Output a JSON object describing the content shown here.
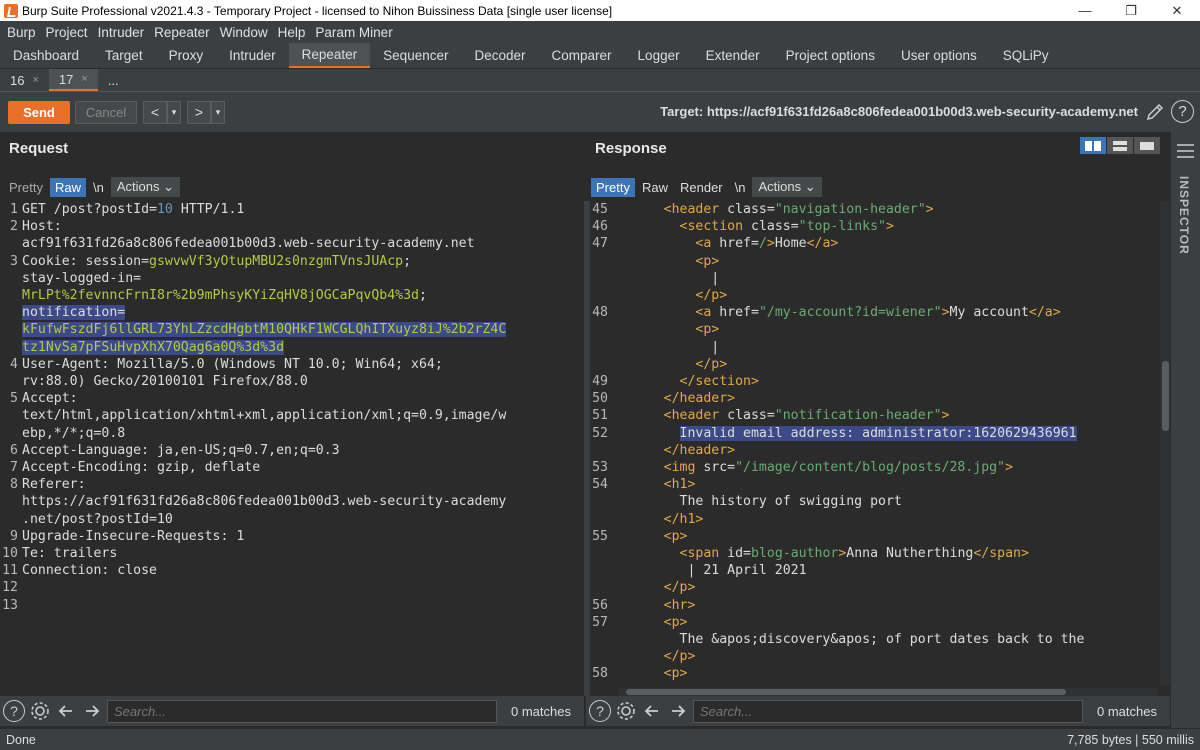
{
  "window": {
    "title": "Burp Suite Professional v2021.4.3 - Temporary Project - licensed to Nihon Buissiness Data [single user license]",
    "minimize": "—",
    "restore": "❐",
    "close": "✕"
  },
  "menu": [
    "Burp",
    "Project",
    "Intruder",
    "Repeater",
    "Window",
    "Help",
    "Param Miner"
  ],
  "tabs": [
    "Dashboard",
    "Target",
    "Proxy",
    "Intruder",
    "Repeater",
    "Sequencer",
    "Decoder",
    "Comparer",
    "Logger",
    "Extender",
    "Project options",
    "User options",
    "SQLiPy"
  ],
  "active_tab": "Repeater",
  "subtabs": [
    {
      "label": "16",
      "close": "×"
    },
    {
      "label": "17",
      "close": "×"
    },
    {
      "label": "...",
      "close": ""
    }
  ],
  "toolbar": {
    "send": "Send",
    "cancel": "Cancel",
    "back": "<",
    "back_dd": "▾",
    "fwd": ">",
    "fwd_dd": "▾",
    "target_label": "Target:",
    "target_url": "https://acf91f631fd26a8c806fedea001b00d3.web-security-academy.net",
    "help": "?"
  },
  "request": {
    "title": "Request",
    "formats": [
      "Pretty",
      "Raw",
      "\\n"
    ],
    "active_format": "Raw",
    "actions": "Actions ⌄"
  },
  "response": {
    "title": "Response",
    "formats": [
      "Pretty",
      "Raw",
      "Render",
      "\\n"
    ],
    "active_format": "Pretty",
    "actions": "Actions ⌄"
  },
  "inspector": {
    "label": "INSPECTOR"
  },
  "search": {
    "placeholder": "Search...",
    "req_matches": "0 matches",
    "resp_matches": "0 matches",
    "help": "?"
  },
  "status": {
    "left": "Done",
    "right": "7,785 bytes | 550 millis"
  }
}
